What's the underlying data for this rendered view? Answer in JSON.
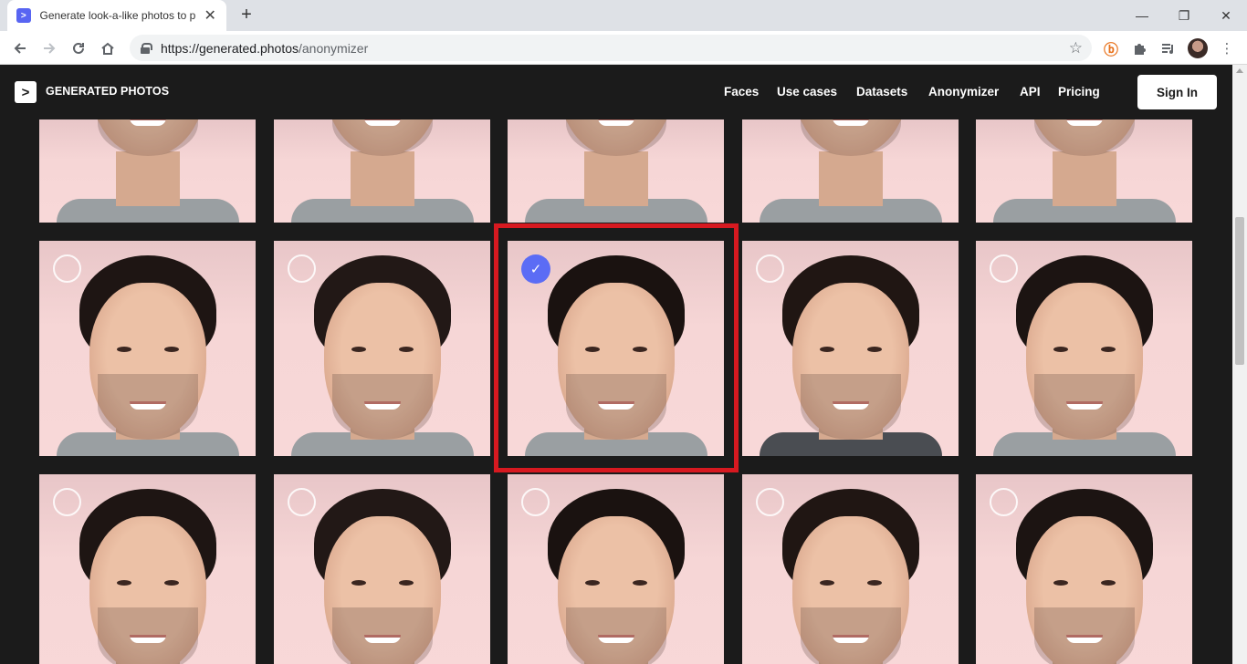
{
  "browser": {
    "tab_title": "Generate look-a-like photos to p",
    "tab_favicon": ">",
    "tab_close": "✕",
    "new_tab": "+",
    "url_host": "https://generated.photos",
    "url_path": "/anonymizer",
    "minimize": "—",
    "restore": "❐",
    "close": "✕"
  },
  "site": {
    "logo_glyph": ">",
    "logo_text": "GENERATED PHOTOS",
    "nav": [
      "Faces",
      "Use cases",
      "Datasets",
      "Anonymizer",
      "API",
      "Pricing"
    ],
    "signin_label": "Sign In",
    "check_glyph": "✓"
  },
  "gallery": {
    "selected_index": 7,
    "rows": 3,
    "columns": 5
  },
  "colors": {
    "accent": "#5b6cf5",
    "highlight": "#d71920",
    "card_bg": "#f6d6d6"
  }
}
